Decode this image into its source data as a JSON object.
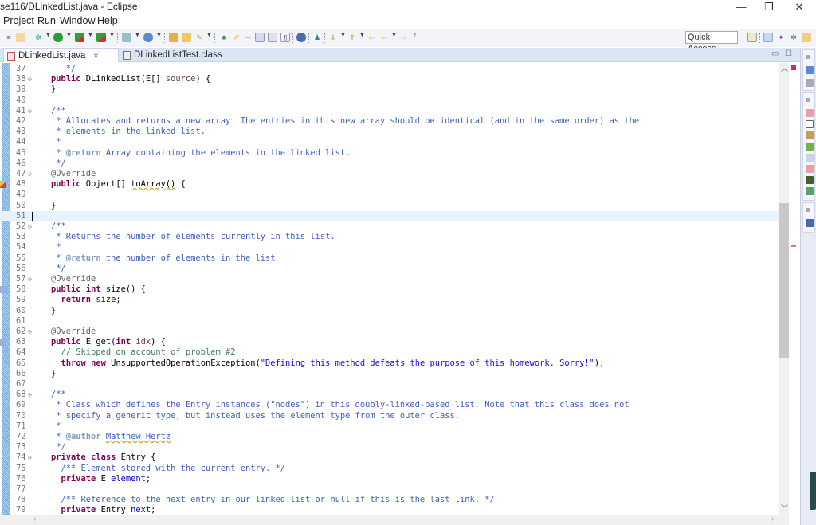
{
  "window": {
    "title": "se116/DLinkedList.java - Eclipse",
    "controls": {
      "minimize": "—",
      "maximize": "❐",
      "close": "✕"
    }
  },
  "menu": [
    {
      "label": "Project",
      "mnemonic": "P"
    },
    {
      "label": "Run",
      "mnemonic": "R"
    },
    {
      "label": "Window",
      "mnemonic": "W"
    },
    {
      "label": "Help",
      "mnemonic": "H"
    }
  ],
  "toolbar": {
    "icons": [
      "toggle-ant-icon",
      "toggle-breadcrumb-icon",
      "debug-icon",
      "run-icon",
      "coverage-icon",
      "external-tools-icon",
      "new-java-project-icon",
      "new-java-class-icon",
      "open-type-icon",
      "open-task-icon",
      "search-icon",
      "toggle-mark-occurrences-icon",
      "toggle-block-selection-icon",
      "show-whitespace-icon",
      "paragraph-icon",
      "globe-icon",
      "pin-editor-icon",
      "next-annotation-icon",
      "previous-annotation-icon",
      "last-edit-location-icon",
      "back-icon",
      "forward-icon"
    ],
    "quick_access": "Quick Access",
    "perspectives": [
      "open-perspective-icon",
      "java-ee-perspective-icon",
      "java-perspective-icon",
      "debug-perspective-icon",
      "resource-perspective-icon"
    ]
  },
  "tabs": [
    {
      "label": "DLinkedList.java",
      "close": "✕",
      "active": true
    },
    {
      "label": "DLinkedListTest.class",
      "active": false
    }
  ],
  "editor": {
    "current_line": 51,
    "lines": [
      {
        "n": "37",
        "fold": "",
        "marker": "",
        "html": "<span class='cm'>   */</span>"
      },
      {
        "n": "38",
        "fold": "⊖",
        "marker": "",
        "html": "<span class='kw'>public</span> DLinkedList(E[] <span class='pm'>source</span>) {"
      },
      {
        "n": "39",
        "fold": "",
        "marker": "",
        "html": "}"
      },
      {
        "n": "40",
        "fold": "",
        "marker": "",
        "html": ""
      },
      {
        "n": "41",
        "fold": "⊖",
        "marker": "",
        "html": "<span class='cm'>/**</span>"
      },
      {
        "n": "42",
        "fold": "",
        "marker": "",
        "html": "<span class='cm'> * Allocates and returns a new array. The entries in this new array should be identical (and in the same order) as the</span>"
      },
      {
        "n": "43",
        "fold": "",
        "marker": "",
        "html": "<span class='cm'> * elements in the linked list.</span>"
      },
      {
        "n": "44",
        "fold": "",
        "marker": "",
        "html": "<span class='cm'> *</span>"
      },
      {
        "n": "45",
        "fold": "",
        "marker": "",
        "html": "<span class='cm'> * <span class='tag'>@return</span> Array containing the elements in the linked list.</span>"
      },
      {
        "n": "46",
        "fold": "",
        "marker": "",
        "html": "<span class='cm'> */</span>"
      },
      {
        "n": "47",
        "fold": "⊖",
        "marker": "",
        "html": "<span class='an'>@Override</span>"
      },
      {
        "n": "48",
        "fold": "",
        "marker": "error",
        "html": "<span class='kw'>public</span> Object[] <span class='squig'>toArray()</span> {"
      },
      {
        "n": "49",
        "fold": "",
        "marker": "",
        "html": ""
      },
      {
        "n": "50",
        "fold": "",
        "marker": "",
        "html": "}"
      },
      {
        "n": "51",
        "fold": "",
        "marker": "",
        "html": ""
      },
      {
        "n": "52",
        "fold": "⊖",
        "marker": "",
        "html": "<span class='cm'>/**</span>"
      },
      {
        "n": "53",
        "fold": "",
        "marker": "",
        "html": "<span class='cm'> * Returns the number of elements currently in this list.</span>"
      },
      {
        "n": "54",
        "fold": "",
        "marker": "",
        "html": "<span class='cm'> *</span>"
      },
      {
        "n": "55",
        "fold": "",
        "marker": "",
        "html": "<span class='cm'> * <span class='tag'>@return</span> the number of elements in the list</span>"
      },
      {
        "n": "56",
        "fold": "",
        "marker": "",
        "html": "<span class='cm'> */</span>"
      },
      {
        "n": "57",
        "fold": "⊖",
        "marker": "",
        "html": "<span class='an'>@Override</span>"
      },
      {
        "n": "58",
        "fold": "",
        "marker": "override",
        "html": "<span class='kw'>public</span> <span class='kw'>int</span> size() {"
      },
      {
        "n": "59",
        "fold": "",
        "marker": "",
        "html": "  <span class='kw'>return</span> <span class='fld'>size</span>;"
      },
      {
        "n": "60",
        "fold": "",
        "marker": "",
        "html": "}"
      },
      {
        "n": "61",
        "fold": "",
        "marker": "",
        "html": ""
      },
      {
        "n": "62",
        "fold": "⊖",
        "marker": "",
        "html": "<span class='an'>@Override</span>"
      },
      {
        "n": "63",
        "fold": "",
        "marker": "override",
        "html": "<span class='kw'>public</span> E get(<span class='kw'>int</span> <span class='pm'>idx</span>) {"
      },
      {
        "n": "64",
        "fold": "",
        "marker": "",
        "html": "  <span class='lc'>// Skipped on account of problem #2</span>"
      },
      {
        "n": "65",
        "fold": "",
        "marker": "",
        "html": "  <span class='kw'>throw</span> <span class='kw'>new</span> UnsupportedOperationException(<span class='st'>\"Defining this method defeats the purpose of this homework. Sorry!\"</span>);"
      },
      {
        "n": "66",
        "fold": "",
        "marker": "",
        "html": "}"
      },
      {
        "n": "67",
        "fold": "",
        "marker": "",
        "html": ""
      },
      {
        "n": "68",
        "fold": "⊖",
        "marker": "",
        "html": "<span class='cm'>/**</span>"
      },
      {
        "n": "69",
        "fold": "",
        "marker": "",
        "html": "<span class='cm'> * Class which defines the Entry instances (\"nodes\") in this doubly-linked-based list. Note that this class does not</span>"
      },
      {
        "n": "70",
        "fold": "",
        "marker": "",
        "html": "<span class='cm'> * specify a generic type, but instead uses the element type from the outer class.</span>"
      },
      {
        "n": "71",
        "fold": "",
        "marker": "",
        "html": "<span class='cm'> *</span>"
      },
      {
        "n": "72",
        "fold": "",
        "marker": "",
        "html": "<span class='cm'> * <span class='tag'>@author</span> <span class='squig'>Matthew Hertz</span></span>"
      },
      {
        "n": "73",
        "fold": "",
        "marker": "",
        "html": "<span class='cm'> */</span>"
      },
      {
        "n": "74",
        "fold": "⊖",
        "marker": "",
        "html": "<span class='kw'>private</span> <span class='kw'>class</span> Entry {"
      },
      {
        "n": "75",
        "fold": "",
        "marker": "",
        "html": "  <span class='cm'>/** Element stored with the current entry. */</span>"
      },
      {
        "n": "76",
        "fold": "",
        "marker": "",
        "html": "  <span class='kw'>private</span> E <span class='fld'>element</span>;"
      },
      {
        "n": "77",
        "fold": "",
        "marker": "",
        "html": ""
      },
      {
        "n": "78",
        "fold": "",
        "marker": "",
        "html": "  <span class='cm'>/** Reference to the next entry in our linked list or null if this is the last link. */</span>"
      },
      {
        "n": "79",
        "fold": "",
        "marker": "",
        "html": "  <span class='kw'>private</span> Entry <span class='fld'>next</span>;"
      }
    ]
  },
  "scroll": {
    "vertical_position": 0.31,
    "vertical_visible": 0.34
  }
}
